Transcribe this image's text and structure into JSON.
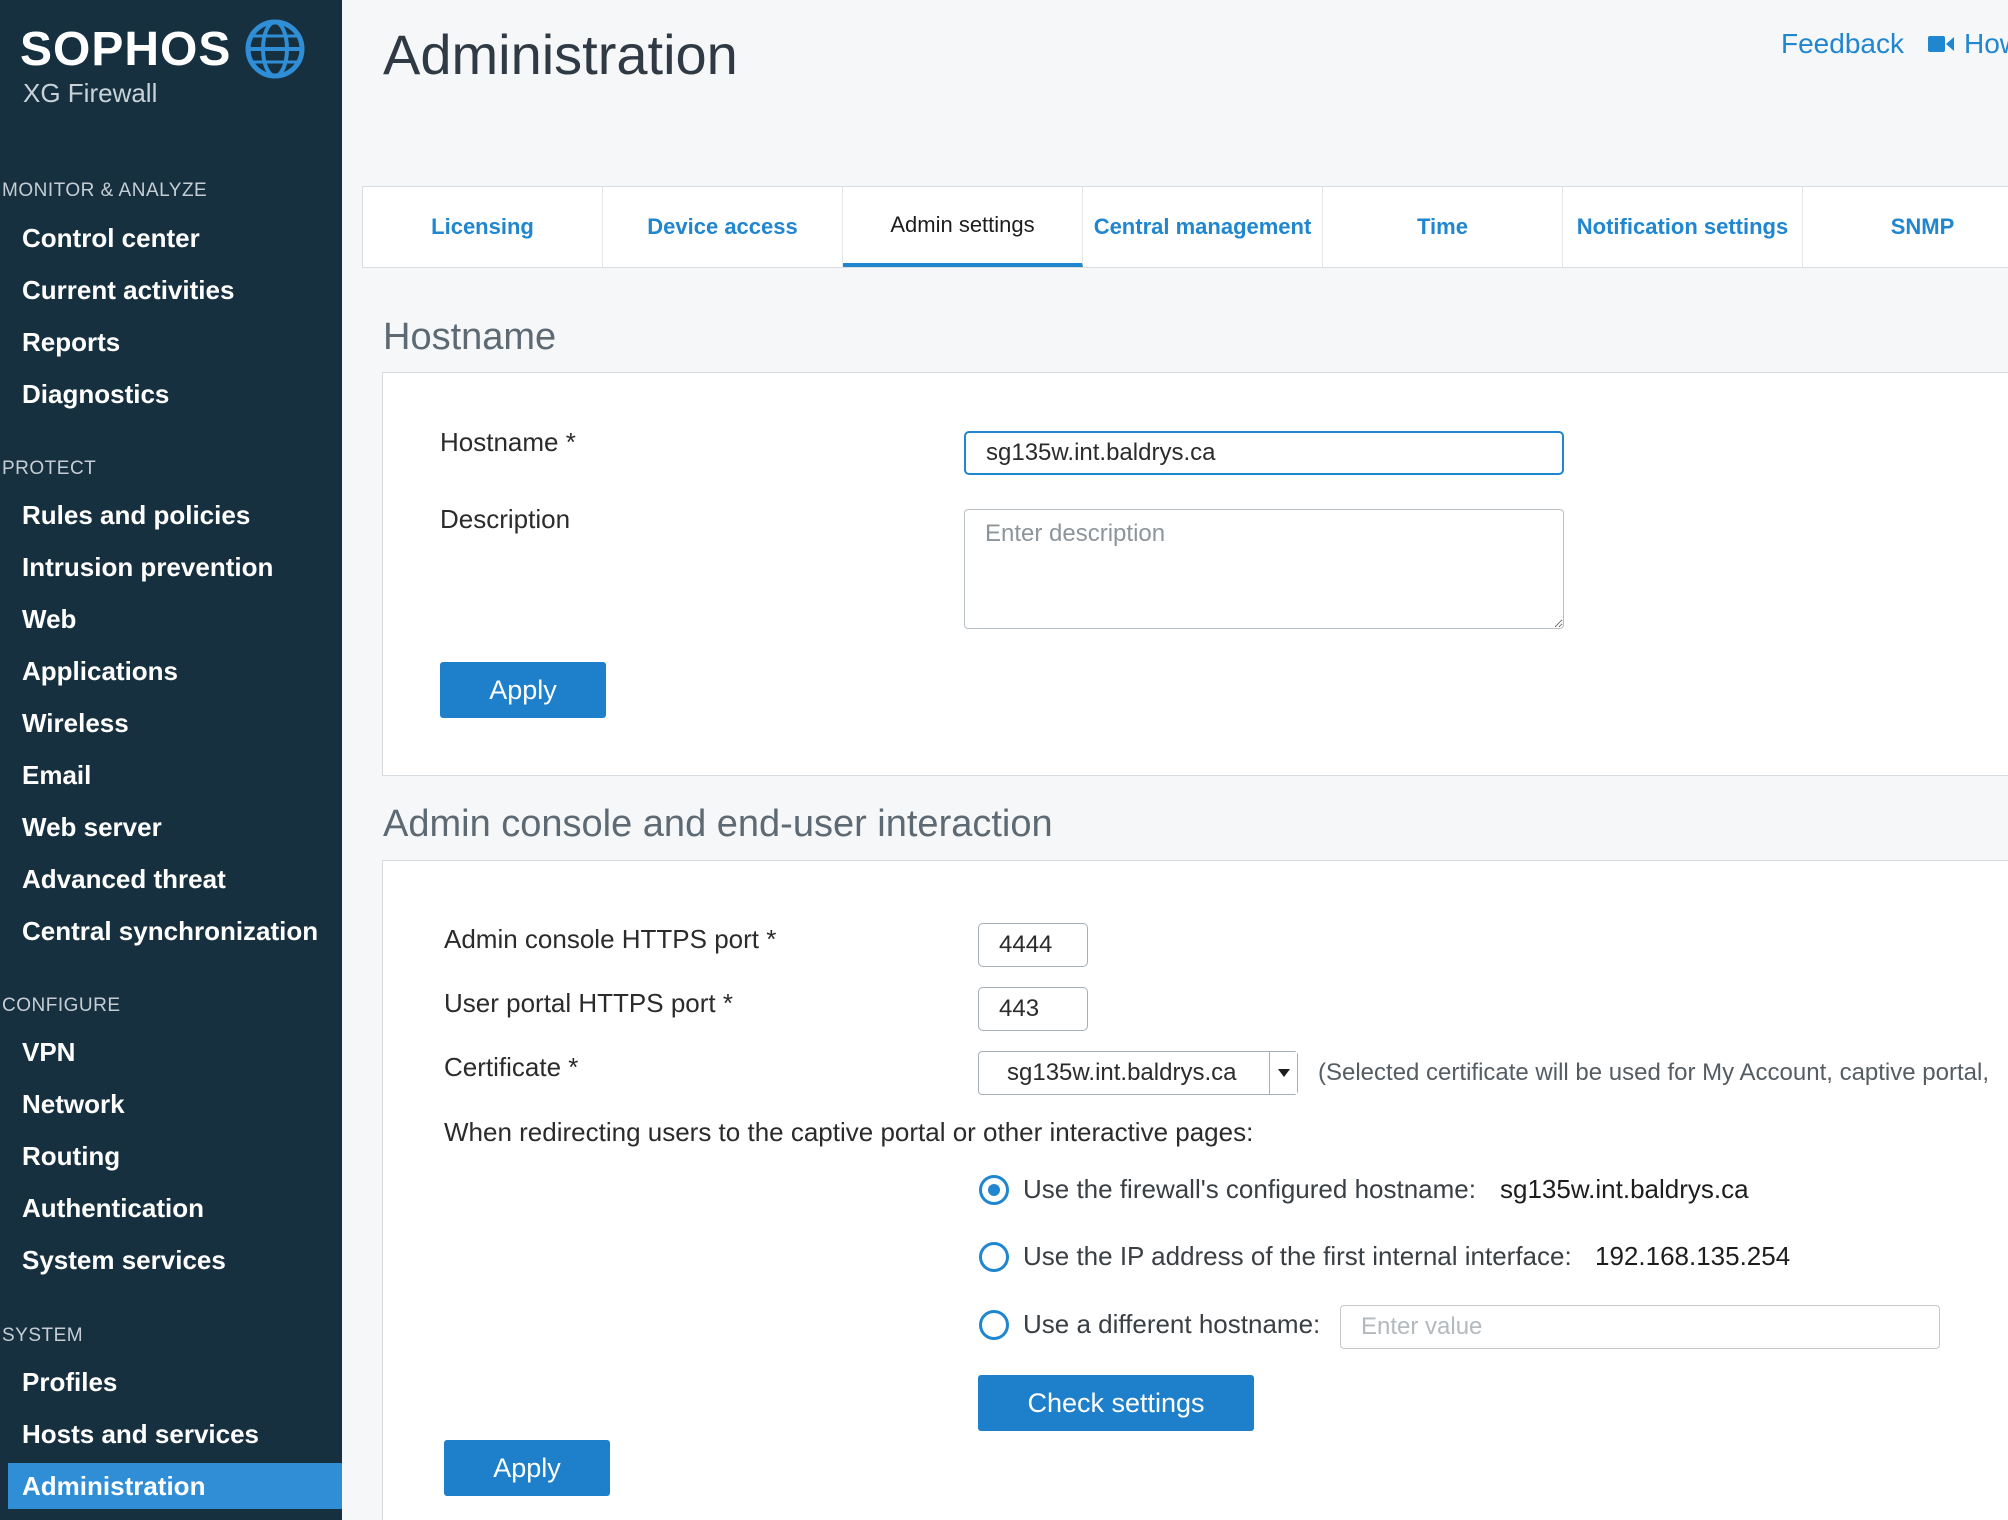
{
  "brand": {
    "name": "SOPHOS",
    "product": "XG Firewall"
  },
  "sidebar": {
    "sections": [
      {
        "title": "MONITOR & ANALYZE",
        "items": [
          "Control center",
          "Current activities",
          "Reports",
          "Diagnostics"
        ]
      },
      {
        "title": "PROTECT",
        "items": [
          "Rules and policies",
          "Intrusion prevention",
          "Web",
          "Applications",
          "Wireless",
          "Email",
          "Web server",
          "Advanced threat",
          "Central synchronization"
        ]
      },
      {
        "title": "CONFIGURE",
        "items": [
          "VPN",
          "Network",
          "Routing",
          "Authentication",
          "System services"
        ]
      },
      {
        "title": "SYSTEM",
        "items": [
          "Profiles",
          "Hosts and services",
          "Administration"
        ]
      }
    ],
    "active_item": "Administration"
  },
  "header": {
    "title": "Administration",
    "feedback": "Feedback",
    "howto": "How"
  },
  "tabs": [
    {
      "label": "Licensing",
      "active": false
    },
    {
      "label": "Device access",
      "active": false
    },
    {
      "label": "Admin settings",
      "active": true
    },
    {
      "label": "Central management",
      "active": false
    },
    {
      "label": "Time",
      "active": false
    },
    {
      "label": "Notification settings",
      "active": false
    },
    {
      "label": "SNMP",
      "active": false
    }
  ],
  "hostname_section": {
    "title": "Hostname",
    "hostname_label": "Hostname *",
    "hostname_value": "sg135w.int.baldrys.ca",
    "description_label": "Description",
    "description_placeholder": "Enter description",
    "apply_label": "Apply"
  },
  "admin_section": {
    "title": "Admin console and end-user interaction",
    "admin_port_label": "Admin console HTTPS port *",
    "admin_port_value": "4444",
    "user_port_label": "User portal HTTPS port *",
    "user_port_value": "443",
    "certificate_label": "Certificate *",
    "certificate_value": "sg135w.int.baldrys.ca",
    "certificate_hint": "(Selected certificate will be used for My Account, captive portal,",
    "redirect_text": "When redirecting users to the captive portal or other interactive pages:",
    "options": [
      {
        "text": "Use the firewall's configured hostname:",
        "value": "sg135w.int.baldrys.ca",
        "checked": true
      },
      {
        "text": "Use the IP address of the first internal interface:",
        "value": "192.168.135.254",
        "checked": false
      },
      {
        "text": "Use a different hostname:",
        "placeholder": "Enter value",
        "checked": false
      }
    ],
    "check_settings_label": "Check settings",
    "apply_label": "Apply"
  },
  "colors": {
    "sidebar_bg": "#17303f",
    "accent": "#1f86cf",
    "active_nav": "#2f8ed6",
    "button": "#1e7fcb"
  }
}
